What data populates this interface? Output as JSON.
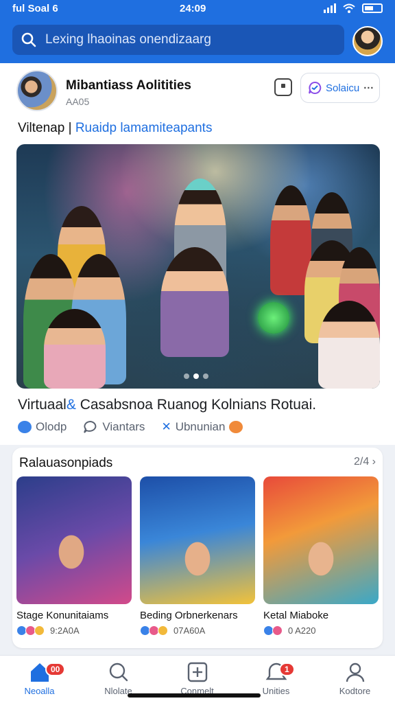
{
  "status_bar": {
    "carrier": "ful Soal 6",
    "time": "24:09"
  },
  "search": {
    "placeholder": "Lexing lhaoinas onendizaarg"
  },
  "post": {
    "author": "Mibantiass Aolitities",
    "subtitle": "AA05",
    "follow_label": "Solaicu",
    "headline_prefix": "Viltenap |",
    "headline_highlight": "Ruaidp lamamiteapants",
    "caption_prefix": "Virtuaal",
    "caption_rest": "Casabsnoa Ruanog Kolnians Rotuai.",
    "caption_highlight": "Kolnians",
    "actions": [
      {
        "label": "Olodp",
        "icon": "like-icon"
      },
      {
        "label": "Viantars",
        "icon": "comment-icon"
      },
      {
        "label": "Ubnunian",
        "icon": "share-icon"
      }
    ],
    "carousel": {
      "count": 3,
      "active": 1
    }
  },
  "recommendations": {
    "title": "Ralauasonpiads",
    "count": "2/4",
    "items": [
      {
        "title": "Stage Konunitaiams",
        "meta": "9:2A0A"
      },
      {
        "title": "Beding Orbnerkenars",
        "meta": "07A60A"
      },
      {
        "title": "Ketal Miaboke",
        "meta": "0 A220"
      }
    ]
  },
  "tabs": [
    {
      "label": "Neoalla",
      "icon": "home-icon",
      "badge": "00",
      "active": true
    },
    {
      "label": "Nlolate",
      "icon": "search-icon",
      "badge": "",
      "active": false
    },
    {
      "label": "Conmelt",
      "icon": "create-icon",
      "badge": "",
      "active": false
    },
    {
      "label": "Unities",
      "icon": "notifications-icon",
      "badge": "1",
      "active": false
    },
    {
      "label": "Kodtore",
      "icon": "profile-icon",
      "badge": "",
      "active": false
    }
  ],
  "colors": {
    "brand": "#1f6fe0",
    "badge": "#e53935"
  }
}
